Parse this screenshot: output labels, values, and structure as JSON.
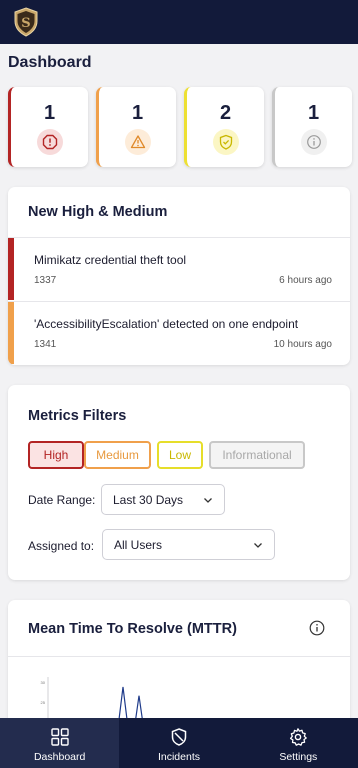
{
  "page_title": "Dashboard",
  "stats": [
    {
      "count": "1",
      "severity": "high",
      "icon": "alert-octagon-icon",
      "color": "#b32424"
    },
    {
      "count": "1",
      "severity": "medium",
      "icon": "warning-triangle-icon",
      "color": "#f0a04b"
    },
    {
      "count": "2",
      "severity": "low",
      "icon": "shield-check-icon",
      "color": "#ede033"
    },
    {
      "count": "1",
      "severity": "informational",
      "icon": "info-circle-icon",
      "color": "#c8c8c8"
    }
  ],
  "new_incidents": {
    "title": "New High & Medium",
    "items": [
      {
        "title": "Mimikatz credential theft tool",
        "id": "1337",
        "time": "6 hours ago",
        "severity_color": "#b32424"
      },
      {
        "title": "'AccessibilityEscalation' detected on one endpoint",
        "id": "1341",
        "time": "10 hours ago",
        "severity_color": "#f0a04b"
      }
    ]
  },
  "filters": {
    "title": "Metrics Filters",
    "chips": [
      {
        "label": "High",
        "color": "#b32424"
      },
      {
        "label": "Medium",
        "color": "#f0a04b"
      },
      {
        "label": "Low",
        "color": "#d8c800"
      },
      {
        "label": "Informational",
        "color": "#a8a8a8"
      }
    ],
    "date_range_label": "Date Range:",
    "date_range_value": "Last 30 Days",
    "assigned_label": "Assigned to:",
    "assigned_value": "All Users"
  },
  "mttr": {
    "title": "Mean Time To Resolve (MTTR)"
  },
  "chart_data": {
    "type": "line",
    "title": "",
    "xlabel": "",
    "ylabel": "",
    "yticks": [
      "30",
      "25"
    ],
    "series": [
      {
        "values": [
          0,
          0,
          0,
          0,
          30,
          0,
          26,
          0
        ]
      }
    ]
  },
  "nav": [
    {
      "label": "Dashboard",
      "icon": "grid-icon",
      "active": true
    },
    {
      "label": "Incidents",
      "icon": "shield-icon",
      "active": false
    },
    {
      "label": "Settings",
      "icon": "gear-icon",
      "active": false
    }
  ],
  "colors": {
    "navy": "#121a3a",
    "accent_gold": "#c9a76a"
  }
}
